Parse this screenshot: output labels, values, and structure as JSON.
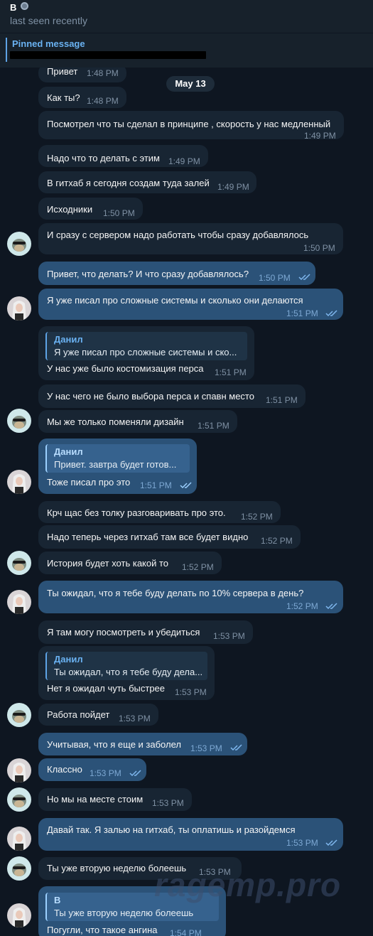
{
  "chat_header": {
    "name": "B",
    "status": "last seen recently"
  },
  "pinned": {
    "title": "Pinned message"
  },
  "date_separator": "May 13",
  "messages": [
    {
      "text": "Привет",
      "time": "1:48 PM"
    },
    {
      "text": "Как ты?",
      "time": "1:48 PM"
    },
    {
      "text": "Посмотрел что ты сделал в принципе , скорость у нас медленный",
      "time": "1:49 PM"
    },
    {
      "text": "Надо что то делать с этим",
      "time": "1:49 PM"
    },
    {
      "text": "В гитхаб я сегодня создам туда залей",
      "time": "1:49 PM"
    },
    {
      "text": "Исходники",
      "time": "1:50 PM"
    },
    {
      "text": "И сразу с сервером надо работать чтобы сразу добавлялось",
      "time": "1:50 PM"
    },
    {
      "text": "Привет, что делать? И что сразу добавлялось?",
      "time": "1:50 PM"
    },
    {
      "text": "Я уже писал про сложные системы и сколько они делаются",
      "time": "1:51 PM"
    },
    {
      "reply_name": "Данил",
      "reply_text": "Я уже писал про сложные системы и ско...",
      "text": "У нас уже было костомизация перса",
      "time": "1:51 PM"
    },
    {
      "text": "У нас чего не было выбора перса и спавн место",
      "time": "1:51 PM"
    },
    {
      "text": "Мы же только поменяли дизайн",
      "time": "1:51 PM"
    },
    {
      "reply_name": "Данил",
      "reply_text": "Привет.  завтра будет готов...",
      "text": "Тоже писал про это",
      "time": "1:51 PM"
    },
    {
      "text": "Крч щас без толку разговаривать про это.",
      "time": "1:52 PM"
    },
    {
      "text": "Надо теперь через гитхаб там все будет видно",
      "time": "1:52 PM"
    },
    {
      "text": "История будет хоть какой то",
      "time": "1:52 PM"
    },
    {
      "text": "Ты ожидал, что я тебе буду делать по 10% сервера в день?",
      "time": "1:52 PM"
    },
    {
      "text": "Я там могу посмотреть и убедиться",
      "time": "1:53 PM"
    },
    {
      "reply_name": "Данил",
      "reply_text": "Ты ожидал, что я тебе буду дела...",
      "text": "Нет я ожидал чуть быстрее",
      "time": "1:53 PM"
    },
    {
      "text": "Работа пойдет",
      "time": "1:53 PM"
    },
    {
      "text": "Учитывая, что я еще и заболел",
      "time": "1:53 PM"
    },
    {
      "text": "Классно",
      "time": "1:53 PM"
    },
    {
      "text": "Но мы на месте стоим",
      "time": "1:53 PM"
    },
    {
      "text": "Давай так. Я залью на гитхаб, ты оплатишь и разойдемся",
      "time": "1:53 PM"
    },
    {
      "text": "Ты уже вторую неделю болеешь",
      "time": "1:53 PM"
    },
    {
      "reply_name": "B",
      "reply_text": "Ты уже вторую неделю болеешь",
      "text": "Погугли, что такое ангина",
      "time": "1:54 PM"
    }
  ],
  "watermark": "ragemp.pro",
  "colors": {
    "background": "#0e1621",
    "incoming": "#182533",
    "outgoing": "#2b5278",
    "accent": "#6ab2f2"
  }
}
